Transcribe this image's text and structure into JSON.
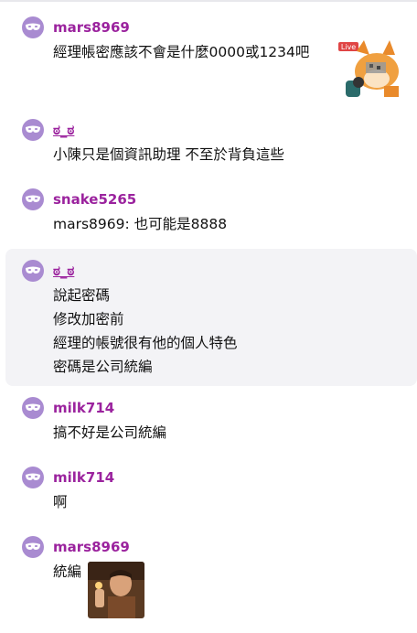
{
  "messages": [
    {
      "user": "mars8969",
      "lines": [
        "經理帳密應該不會是什麼0000或1234吧"
      ],
      "sticker": "fox-live-sticker",
      "sticker_badge": "Live"
    },
    {
      "user": "ಠ_ಠ",
      "lines": [
        "小陳只是個資訊助理 不至於背負這些"
      ]
    },
    {
      "user": "snake5265",
      "lines": [
        "mars8969: 也可能是8888"
      ]
    },
    {
      "user": "ಠ_ಠ",
      "lines": [
        "說起密碼",
        "修改加密前",
        "經理的帳號很有他的個人特色",
        "密碼是公司統編"
      ],
      "highlighted": true
    },
    {
      "user": "milk714",
      "lines": [
        "搞不好是公司統編"
      ]
    },
    {
      "user": "milk714",
      "lines": [
        "啊"
      ]
    },
    {
      "user": "mars8969",
      "lines": [
        "統編"
      ],
      "sticker": "man-photo-sticker"
    }
  ],
  "colors": {
    "username": "#9b239e",
    "avatar": "#a98bd1",
    "highlight": "#f3f3f6"
  },
  "icons": {
    "avatar": "mask-icon"
  }
}
